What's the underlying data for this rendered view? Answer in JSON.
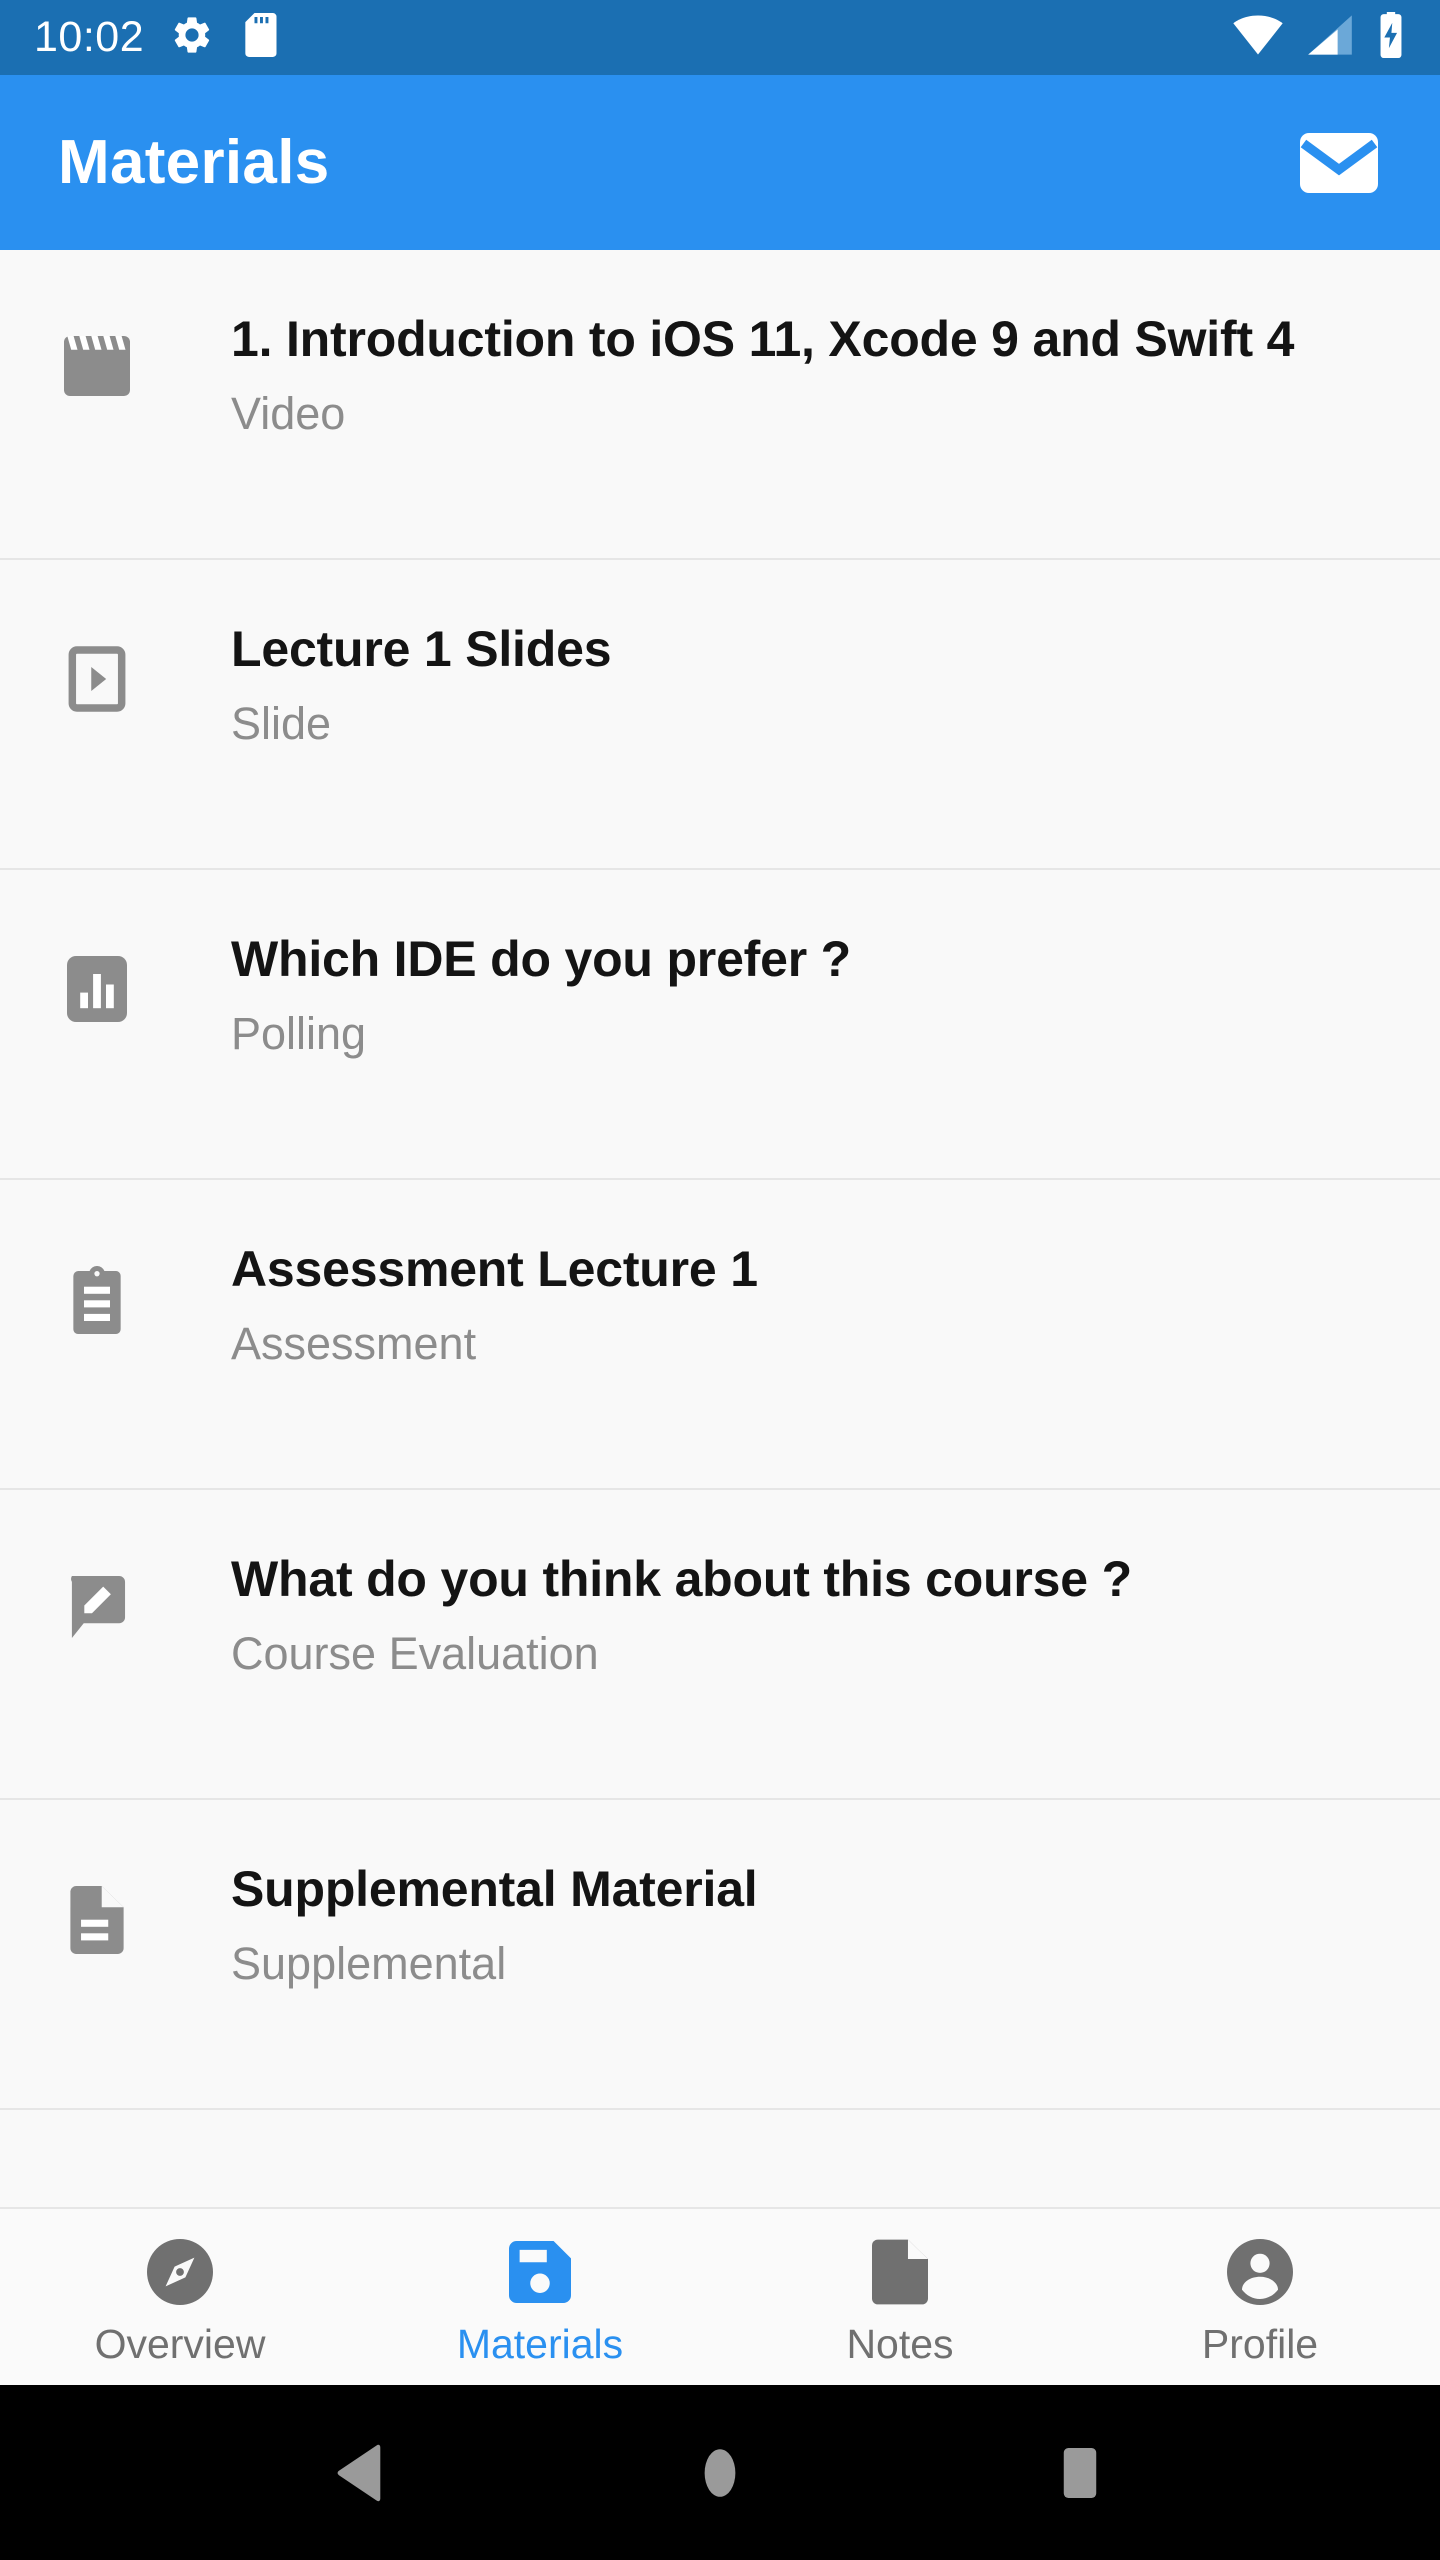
{
  "status_bar": {
    "time": "10:02",
    "left_icons": [
      "settings-gear-icon",
      "sd-card-icon"
    ],
    "right_icons": [
      "wifi-icon",
      "cellular-signal-icon",
      "battery-charging-icon"
    ],
    "background_color": "#1b6fb2",
    "foreground_color": "#ffffff"
  },
  "app_bar": {
    "title": "Materials",
    "background_color": "#2a90f0",
    "action_icon": "mail-envelope-icon"
  },
  "materials_list": [
    {
      "title": "1. Introduction to iOS 11, Xcode 9 and Swift 4",
      "subtitle": "Video",
      "icon": "movie-clapperboard-icon"
    },
    {
      "title": "Lecture 1 Slides",
      "subtitle": "Slide",
      "icon": "slideshow-play-icon"
    },
    {
      "title": "Which IDE do you prefer ?",
      "subtitle": "Polling",
      "icon": "bar-chart-poll-icon"
    },
    {
      "title": "Assessment Lecture 1",
      "subtitle": "Assessment",
      "icon": "clipboard-assignment-icon"
    },
    {
      "title": "What do you think about this course ?",
      "subtitle": "Course Evaluation",
      "icon": "rate-review-icon"
    },
    {
      "title": "Supplemental Material",
      "subtitle": "Supplemental",
      "icon": "document-file-icon"
    }
  ],
  "bottom_nav": {
    "active_index": 1,
    "active_color": "#2a90f0",
    "inactive_color": "#707070",
    "items": [
      {
        "label": "Overview",
        "icon": "compass-explore-icon"
      },
      {
        "label": "Materials",
        "icon": "save-floppy-disk-icon"
      },
      {
        "label": "Notes",
        "icon": "note-document-icon"
      },
      {
        "label": "Profile",
        "icon": "account-circle-icon"
      }
    ]
  },
  "android_nav": {
    "buttons": [
      "back-triangle-icon",
      "home-circle-icon",
      "recents-square-icon"
    ],
    "background_color": "#000000",
    "icon_color": "#9a9a9a"
  }
}
